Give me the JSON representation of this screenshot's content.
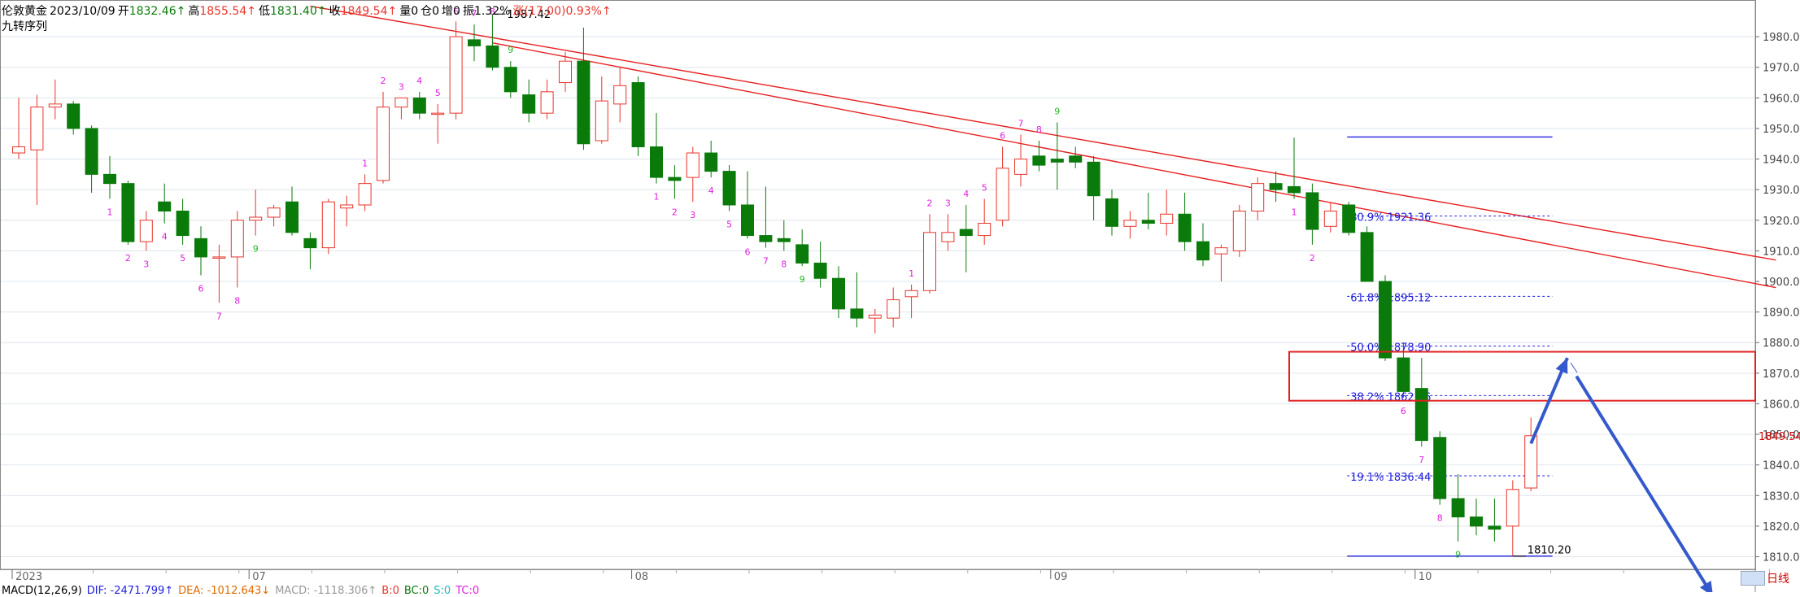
{
  "header": {
    "instrument": "伦敦黄金",
    "date": "2023/10/09",
    "open_label": "开",
    "open_value": "1832.46↑",
    "high_label": "高",
    "high_value": "1855.54↑",
    "low_label": "低",
    "low_value": "1831.40↑",
    "close_label": "收",
    "close_value": "1849.54↑",
    "volume": "量0",
    "position": "仓0",
    "increase": "增0",
    "amplitude": "振1.32%",
    "change": "涨(17.00)0.93%↑"
  },
  "subtitle": "九转序列",
  "indicator": {
    "macd": "MACD(12,26,9)",
    "dif": "DIF: -2471.799↑",
    "dea": "DEA: -1012.643↓",
    "macd_val": "MACD: -1118.306↑",
    "b": "B:0",
    "bc": "BC:0",
    "s": "S:0",
    "tc": "TC:0"
  },
  "period_tab": "日线",
  "colors": {
    "up": "#e8352c",
    "down": "#0a7a0a",
    "trend": "#e82020",
    "fib": "#2222dd",
    "arrow": "#3559cc",
    "count": "#e020e0",
    "count9": "#22bb22",
    "box": "#e02020",
    "price_tag": "#d10000",
    "grid": "#dfe4ec",
    "axis": "#666666"
  },
  "chart_data": {
    "type": "candlestick",
    "ylim": [
      1808,
      1992
    ],
    "yticks": [
      1810,
      1820,
      1830,
      1840,
      1850,
      1860,
      1870,
      1880,
      1890,
      1900,
      1910,
      1920,
      1930,
      1940,
      1950,
      1960,
      1970,
      1980
    ],
    "ytick_labels": [
      "1810.00",
      "1820.00",
      "1830.00",
      "1840.00",
      "1850.00",
      "1860.00",
      "1870.00",
      "1880.00",
      "1890.00",
      "1900.00",
      "1910.00",
      "1920.00",
      "1930.00",
      "1940.00",
      "1950.00",
      "1960.00",
      "1970.00",
      "1980.00"
    ],
    "xticks": [
      {
        "index": 0,
        "label": "2023"
      },
      {
        "index": 13,
        "label": "07"
      },
      {
        "index": 34,
        "label": "08"
      },
      {
        "index": 57,
        "label": "09"
      },
      {
        "index": 77,
        "label": "10"
      }
    ],
    "last_price_label": "1849.54",
    "candles": [
      {
        "o": 1942,
        "h": 1960,
        "l": 1940,
        "c": 1944
      },
      {
        "o": 1943,
        "h": 1961,
        "l": 1925,
        "c": 1957
      },
      {
        "o": 1957,
        "h": 1966,
        "l": 1953,
        "c": 1958
      },
      {
        "o": 1958,
        "h": 1959,
        "l": 1948,
        "c": 1950
      },
      {
        "o": 1950,
        "h": 1951,
        "l": 1929,
        "c": 1935
      },
      {
        "o": 1935,
        "h": 1941,
        "l": 1927,
        "c": 1932
      },
      {
        "o": 1932,
        "h": 1933,
        "l": 1912,
        "c": 1913
      },
      {
        "o": 1913,
        "h": 1923,
        "l": 1910,
        "c": 1920
      },
      {
        "o": 1926,
        "h": 1932,
        "l": 1919,
        "c": 1923
      },
      {
        "o": 1923,
        "h": 1927,
        "l": 1912,
        "c": 1915
      },
      {
        "o": 1914,
        "h": 1918,
        "l": 1902,
        "c": 1908
      },
      {
        "o": 1908,
        "h": 1912,
        "l": 1893,
        "c": 1908
      },
      {
        "o": 1908,
        "h": 1923,
        "l": 1898,
        "c": 1920
      },
      {
        "o": 1920,
        "h": 1930,
        "l": 1915,
        "c": 1921
      },
      {
        "o": 1921,
        "h": 1925,
        "l": 1918,
        "c": 1924
      },
      {
        "o": 1926,
        "h": 1931,
        "l": 1915,
        "c": 1916
      },
      {
        "o": 1914,
        "h": 1916,
        "l": 1904,
        "c": 1911
      },
      {
        "o": 1911,
        "h": 1927,
        "l": 1909,
        "c": 1926
      },
      {
        "o": 1924,
        "h": 1928,
        "l": 1918,
        "c": 1925
      },
      {
        "o": 1925,
        "h": 1935,
        "l": 1923,
        "c": 1932
      },
      {
        "o": 1933,
        "h": 1962,
        "l": 1932,
        "c": 1957
      },
      {
        "o": 1957,
        "h": 1960,
        "l": 1953,
        "c": 1960
      },
      {
        "o": 1960,
        "h": 1962,
        "l": 1953,
        "c": 1955
      },
      {
        "o": 1955,
        "h": 1958,
        "l": 1945,
        "c": 1955
      },
      {
        "o": 1955,
        "h": 1985,
        "l": 1953,
        "c": 1980
      },
      {
        "o": 1979,
        "h": 1984,
        "l": 1972,
        "c": 1977
      },
      {
        "o": 1977,
        "h": 1987.42,
        "l": 1969,
        "c": 1970
      },
      {
        "o": 1970,
        "h": 1972,
        "l": 1960,
        "c": 1962
      },
      {
        "o": 1961,
        "h": 1966,
        "l": 1952,
        "c": 1955
      },
      {
        "o": 1955,
        "h": 1966,
        "l": 1953,
        "c": 1962
      },
      {
        "o": 1965,
        "h": 1975,
        "l": 1962,
        "c": 1972
      },
      {
        "o": 1972,
        "h": 1983,
        "l": 1943,
        "c": 1945
      },
      {
        "o": 1946,
        "h": 1967,
        "l": 1945,
        "c": 1959
      },
      {
        "o": 1958,
        "h": 1970,
        "l": 1952,
        "c": 1964
      },
      {
        "o": 1965,
        "h": 1967,
        "l": 1941,
        "c": 1944
      },
      {
        "o": 1944,
        "h": 1955,
        "l": 1932,
        "c": 1934
      },
      {
        "o": 1934,
        "h": 1938,
        "l": 1927,
        "c": 1933
      },
      {
        "o": 1934,
        "h": 1944,
        "l": 1926,
        "c": 1942
      },
      {
        "o": 1942,
        "h": 1946,
        "l": 1934,
        "c": 1936
      },
      {
        "o": 1936,
        "h": 1938,
        "l": 1923,
        "c": 1925
      },
      {
        "o": 1925,
        "h": 1936,
        "l": 1914,
        "c": 1915
      },
      {
        "o": 1915,
        "h": 1931,
        "l": 1911,
        "c": 1913
      },
      {
        "o": 1914,
        "h": 1920,
        "l": 1910,
        "c": 1913
      },
      {
        "o": 1912,
        "h": 1917,
        "l": 1905,
        "c": 1906
      },
      {
        "o": 1906,
        "h": 1913,
        "l": 1898,
        "c": 1901
      },
      {
        "o": 1901,
        "h": 1905,
        "l": 1888,
        "c": 1891
      },
      {
        "o": 1891,
        "h": 1903,
        "l": 1885,
        "c": 1888
      },
      {
        "o": 1888,
        "h": 1891,
        "l": 1883,
        "c": 1889
      },
      {
        "o": 1888,
        "h": 1898,
        "l": 1885,
        "c": 1894
      },
      {
        "o": 1895,
        "h": 1899,
        "l": 1888,
        "c": 1897
      },
      {
        "o": 1897,
        "h": 1922,
        "l": 1896,
        "c": 1916
      },
      {
        "o": 1913,
        "h": 1922,
        "l": 1910,
        "c": 1916
      },
      {
        "o": 1917,
        "h": 1925,
        "l": 1903,
        "c": 1915
      },
      {
        "o": 1915,
        "h": 1927,
        "l": 1912,
        "c": 1919
      },
      {
        "o": 1920,
        "h": 1944,
        "l": 1918,
        "c": 1937
      },
      {
        "o": 1935,
        "h": 1948,
        "l": 1931,
        "c": 1940
      },
      {
        "o": 1941,
        "h": 1946,
        "l": 1936,
        "c": 1938
      },
      {
        "o": 1940,
        "h": 1952,
        "l": 1930,
        "c": 1939
      },
      {
        "o": 1941,
        "h": 1944,
        "l": 1937,
        "c": 1939
      },
      {
        "o": 1939,
        "h": 1941,
        "l": 1920,
        "c": 1928
      },
      {
        "o": 1927,
        "h": 1930,
        "l": 1915,
        "c": 1918
      },
      {
        "o": 1918,
        "h": 1923,
        "l": 1914,
        "c": 1920
      },
      {
        "o": 1920,
        "h": 1929,
        "l": 1917,
        "c": 1919
      },
      {
        "o": 1919,
        "h": 1930,
        "l": 1915,
        "c": 1922
      },
      {
        "o": 1922,
        "h": 1929,
        "l": 1910,
        "c": 1913
      },
      {
        "o": 1913,
        "h": 1919,
        "l": 1905,
        "c": 1907
      },
      {
        "o": 1909,
        "h": 1912,
        "l": 1900,
        "c": 1911
      },
      {
        "o": 1910,
        "h": 1925,
        "l": 1908,
        "c": 1923
      },
      {
        "o": 1923,
        "h": 1934,
        "l": 1920,
        "c": 1932
      },
      {
        "o": 1932,
        "h": 1936,
        "l": 1926,
        "c": 1930
      },
      {
        "o": 1931,
        "h": 1947,
        "l": 1927,
        "c": 1929
      },
      {
        "o": 1929,
        "h": 1932,
        "l": 1912,
        "c": 1917
      },
      {
        "o": 1918,
        "h": 1926,
        "l": 1916,
        "c": 1923
      },
      {
        "o": 1925,
        "h": 1926,
        "l": 1915,
        "c": 1916
      },
      {
        "o": 1916,
        "h": 1918,
        "l": 1900,
        "c": 1900
      },
      {
        "o": 1900,
        "h": 1902,
        "l": 1874,
        "c": 1875
      },
      {
        "o": 1875,
        "h": 1880,
        "l": 1862,
        "c": 1864
      },
      {
        "o": 1865,
        "h": 1875,
        "l": 1846,
        "c": 1848
      },
      {
        "o": 1849,
        "h": 1851,
        "l": 1827,
        "c": 1829
      },
      {
        "o": 1829,
        "h": 1837,
        "l": 1815,
        "c": 1823
      },
      {
        "o": 1823,
        "h": 1829,
        "l": 1817,
        "c": 1820
      },
      {
        "o": 1820,
        "h": 1829,
        "l": 1815,
        "c": 1819
      },
      {
        "o": 1820,
        "h": 1835,
        "l": 1810.2,
        "c": 1832
      },
      {
        "o": 1832.46,
        "h": 1855.54,
        "l": 1831.4,
        "c": 1849.54
      }
    ],
    "td_counts": [
      {
        "index": 5,
        "label": "1",
        "pos": "below"
      },
      {
        "index": 6,
        "label": "2",
        "pos": "below"
      },
      {
        "index": 7,
        "label": "3",
        "pos": "below"
      },
      {
        "index": 8,
        "label": "4",
        "pos": "below"
      },
      {
        "index": 9,
        "label": "5",
        "pos": "below"
      },
      {
        "index": 10,
        "label": "6",
        "pos": "below"
      },
      {
        "index": 11,
        "label": "7",
        "pos": "below"
      },
      {
        "index": 12,
        "label": "8",
        "pos": "below"
      },
      {
        "index": 13,
        "label": "9",
        "pos": "below"
      },
      {
        "index": 19,
        "label": "1",
        "pos": "above"
      },
      {
        "index": 20,
        "label": "2",
        "pos": "above"
      },
      {
        "index": 21,
        "label": "3",
        "pos": "above"
      },
      {
        "index": 22,
        "label": "4",
        "pos": "above"
      },
      {
        "index": 23,
        "label": "5",
        "pos": "above"
      },
      {
        "index": 24,
        "label": "6",
        "pos": "above"
      },
      {
        "index": 25,
        "label": "7",
        "pos": "above"
      },
      {
        "index": 26,
        "label": "8",
        "pos": "above"
      },
      {
        "index": 27,
        "label": "9",
        "pos": "above"
      },
      {
        "index": 35,
        "label": "1",
        "pos": "below"
      },
      {
        "index": 36,
        "label": "2",
        "pos": "below"
      },
      {
        "index": 37,
        "label": "3",
        "pos": "below"
      },
      {
        "index": 38,
        "label": "4",
        "pos": "below"
      },
      {
        "index": 39,
        "label": "5",
        "pos": "below"
      },
      {
        "index": 40,
        "label": "6",
        "pos": "below"
      },
      {
        "index": 41,
        "label": "7",
        "pos": "below"
      },
      {
        "index": 42,
        "label": "8",
        "pos": "below"
      },
      {
        "index": 43,
        "label": "9",
        "pos": "below"
      },
      {
        "index": 49,
        "label": "1",
        "pos": "above"
      },
      {
        "index": 50,
        "label": "2",
        "pos": "above"
      },
      {
        "index": 51,
        "label": "3",
        "pos": "above"
      },
      {
        "index": 52,
        "label": "4",
        "pos": "above"
      },
      {
        "index": 53,
        "label": "5",
        "pos": "above"
      },
      {
        "index": 54,
        "label": "6",
        "pos": "above"
      },
      {
        "index": 55,
        "label": "7",
        "pos": "above"
      },
      {
        "index": 56,
        "label": "8",
        "pos": "above"
      },
      {
        "index": 57,
        "label": "9",
        "pos": "above"
      },
      {
        "index": 70,
        "label": "1",
        "pos": "below"
      },
      {
        "index": 71,
        "label": "2",
        "pos": "below"
      },
      {
        "index": 76,
        "label": "6",
        "pos": "below"
      },
      {
        "index": 77,
        "label": "7",
        "pos": "below"
      },
      {
        "index": 78,
        "label": "8",
        "pos": "below"
      },
      {
        "index": 79,
        "label": "9",
        "pos": "below"
      }
    ],
    "high_label": {
      "index": 26,
      "value": "1987.42"
    },
    "low_label": {
      "index": 82,
      "value": "1810.20"
    },
    "trendlines": [
      {
        "from_index": 16,
        "from_price": 1990,
        "to_index": 96,
        "to_price": 1907
      },
      {
        "from_index": 26,
        "from_price": 1978,
        "to_index": 96,
        "to_price": 1898
      }
    ],
    "fibonacci": {
      "from_index": 73,
      "to_index": 84,
      "top_price": 1947.2,
      "levels": [
        {
          "price": 1921.36,
          "label": "80.9% 1921.36"
        },
        {
          "price": 1895.12,
          "label": "61.8% 1895.12"
        },
        {
          "price": 1878.9,
          "label": "50.0% 1878.90"
        },
        {
          "price": 1862.66,
          "label": "38.2% 1862.66"
        },
        {
          "price": 1836.44,
          "label": "19.1% 1836.44"
        }
      ],
      "bottom_price": 1810.2
    },
    "resistance_box": {
      "from_index": 70,
      "to_index": 96,
      "top": 1877,
      "bottom": 1861
    },
    "projection_arrow": [
      {
        "index": 83,
        "price": 1847
      },
      {
        "index": 85,
        "price": 1875
      },
      {
        "index": 93,
        "price": 1797
      }
    ]
  }
}
